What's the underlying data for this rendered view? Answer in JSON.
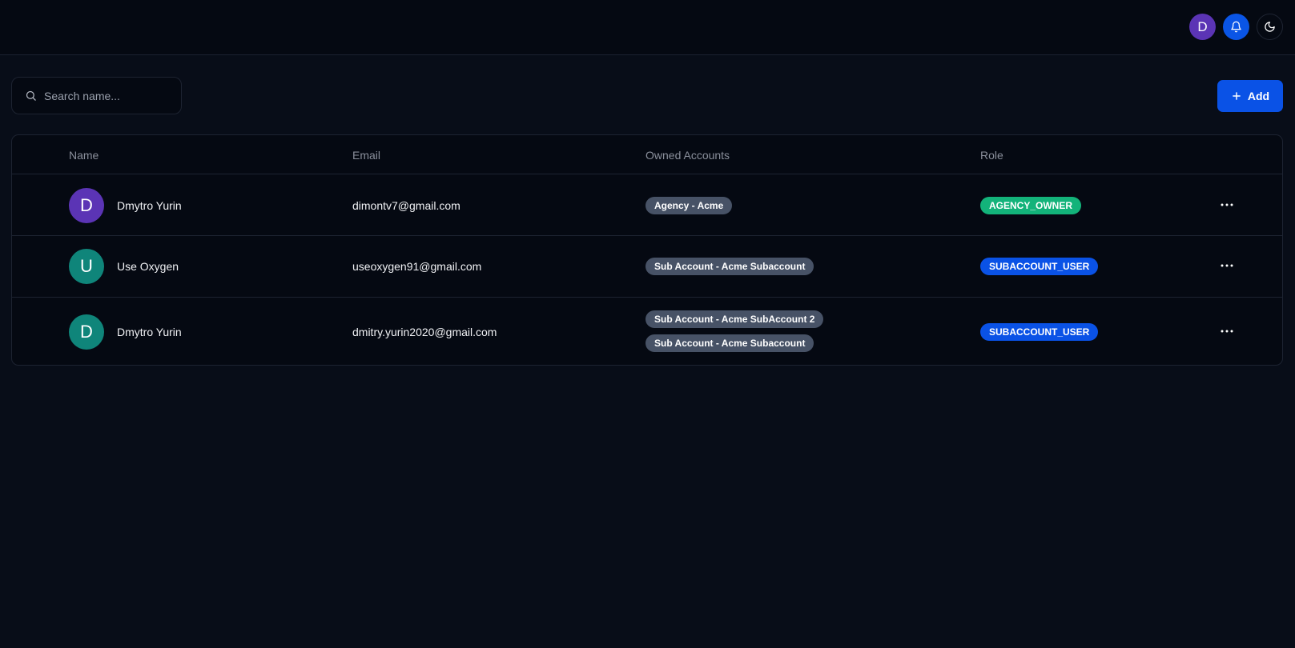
{
  "header": {
    "avatar_letter": "D",
    "avatar_color": "#5b34b5",
    "notifications_icon": "bell-icon",
    "theme_icon": "moon-icon"
  },
  "search": {
    "placeholder": "Search name...",
    "value": ""
  },
  "toolbar": {
    "add_label": "Add"
  },
  "table": {
    "columns": [
      "Name",
      "Email",
      "Owned Accounts",
      "Role"
    ],
    "rows": [
      {
        "avatar": "D",
        "avatar_color": "#5b34b5",
        "name": "Dmytro Yurin",
        "email": "dimontv7@gmail.com",
        "accounts": [
          "Agency - Acme"
        ],
        "role": "AGENCY_OWNER",
        "role_color": "#13b37a"
      },
      {
        "avatar": "U",
        "avatar_color": "#0f857a",
        "name": "Use Oxygen",
        "email": "useoxygen91@gmail.com",
        "accounts": [
          "Sub Account - Acme Subaccount"
        ],
        "role": "SUBACCOUNT_USER",
        "role_color": "#0a52e6"
      },
      {
        "avatar": "D",
        "avatar_color": "#0f857a",
        "name": "Dmytro Yurin",
        "email": "dmitry.yurin2020@gmail.com",
        "accounts": [
          "Sub Account - Acme SubAccount 2",
          "Sub Account - Acme Subaccount"
        ],
        "role": "SUBACCOUNT_USER",
        "role_color": "#0a52e6"
      }
    ]
  },
  "colors": {
    "background": "#080d18",
    "surface": "#050912",
    "accent": "#0a52e6",
    "success": "#13b37a",
    "badge_neutral": "#475266"
  }
}
